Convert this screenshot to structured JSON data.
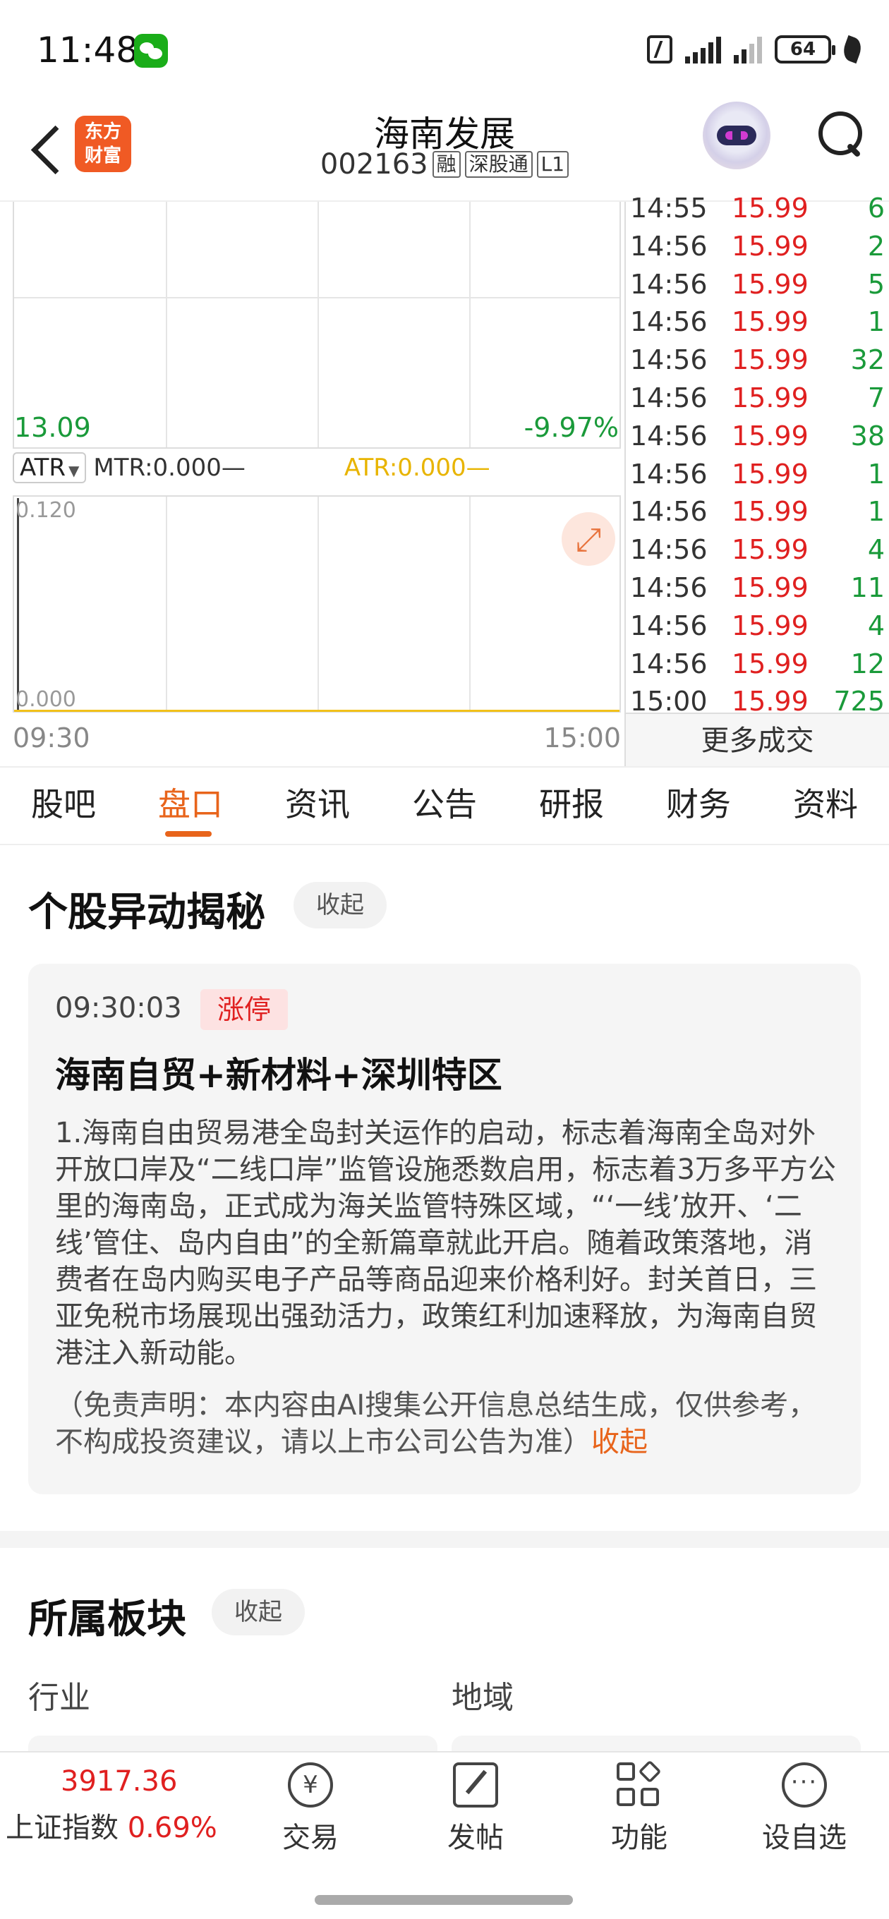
{
  "status_bar": {
    "time": "11:48",
    "battery": "64"
  },
  "header": {
    "logo": "东方\n财富",
    "title": "海南发展",
    "code": "002163",
    "tags": [
      "融",
      "深股通",
      "L1"
    ]
  },
  "chart": {
    "low_price": "13.09",
    "low_pct": "-9.97%",
    "indicator_select": "ATR",
    "mtr_label": "MTR:0.000—",
    "atr_label": "ATR:0.000—",
    "lower_top": "0.120",
    "lower_bottom": "0.000",
    "time_start": "09:30",
    "time_end": "15:00"
  },
  "ticks": [
    {
      "time": "14:55",
      "price": "15.99",
      "vol": "6"
    },
    {
      "time": "14:56",
      "price": "15.99",
      "vol": "2"
    },
    {
      "time": "14:56",
      "price": "15.99",
      "vol": "5"
    },
    {
      "time": "14:56",
      "price": "15.99",
      "vol": "1"
    },
    {
      "time": "14:56",
      "price": "15.99",
      "vol": "32"
    },
    {
      "time": "14:56",
      "price": "15.99",
      "vol": "7"
    },
    {
      "time": "14:56",
      "price": "15.99",
      "vol": "38"
    },
    {
      "time": "14:56",
      "price": "15.99",
      "vol": "1"
    },
    {
      "time": "14:56",
      "price": "15.99",
      "vol": "1"
    },
    {
      "time": "14:56",
      "price": "15.99",
      "vol": "4"
    },
    {
      "time": "14:56",
      "price": "15.99",
      "vol": "11"
    },
    {
      "time": "14:56",
      "price": "15.99",
      "vol": "4"
    },
    {
      "time": "14:56",
      "price": "15.99",
      "vol": "12"
    },
    {
      "time": "15:00",
      "price": "15.99",
      "vol": "725"
    }
  ],
  "more_trades": "更多成交",
  "tabs": [
    "股吧",
    "盘口",
    "资讯",
    "公告",
    "研报",
    "财务",
    "资料"
  ],
  "active_tab": "盘口",
  "section1": {
    "title": "个股异动揭秘",
    "collapse": "收起",
    "card": {
      "time": "09:30:03",
      "badge": "涨停",
      "headline": "海南自贸+新材料+深圳特区",
      "body": "1.海南自由贸易港全岛封关运作的启动，标志着海南全岛对外开放口岸及“二线口岸”监管设施悉数启用，标志着3万多平方公里的海南岛，正式成为海关监管特殊区域，“‘一线’放开、‘二线’管住、岛内自由”的全新篇章就此开启。随着政策落地，消费者在岛内购买电子产品等商品迎来价格利好。封关首日，三亚免税市场展现出强劲活力，政策红利加速释放，为海南自贸港注入新动能。",
      "disclaimer": "（免责声明：本内容由AI搜集公开信息总结生成，仅供参考，不构成投资建议，请以上市公司公告为准）",
      "fold": "收起"
    }
  },
  "section2": {
    "title": "所属板块",
    "collapse": "收起",
    "industry_label": "行业",
    "region_label": "地域"
  },
  "bottom_bar": {
    "index_value": "3917.36",
    "index_name": "上证指数",
    "index_pct": "0.69%",
    "items": [
      "交易",
      "发帖",
      "功能",
      "设自选"
    ]
  }
}
